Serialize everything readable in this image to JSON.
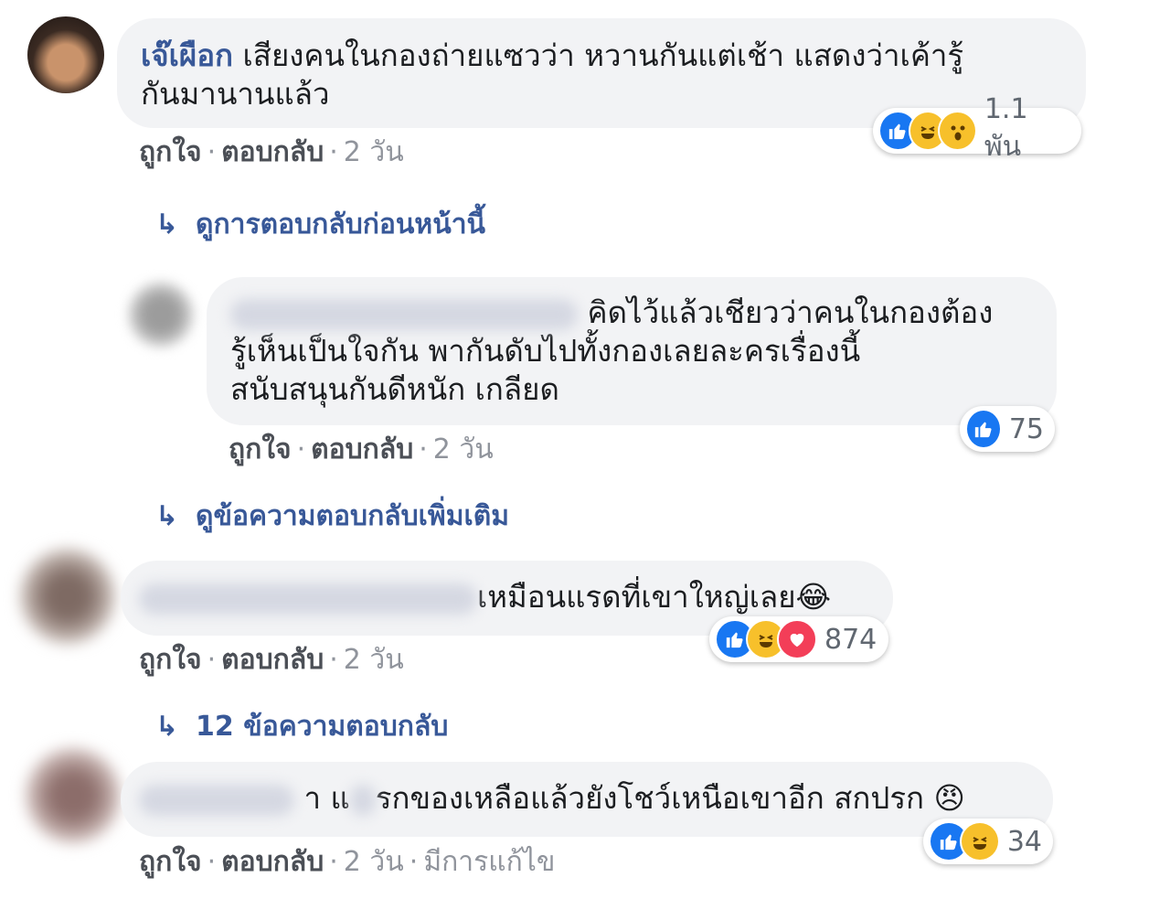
{
  "comments": [
    {
      "author": "เจ๊เผือก",
      "text": "เสียงคนในกองถ่ายแซวว่า หวานกันแต่เช้า แสดงว่าเค้ารู้กันมานานแล้ว",
      "line1": "เสียงคนในกองถ่ายแซวว่า หวานกันแต่เช้า แสดงว่าเค้ารู้",
      "line2": "กันมานานแล้ว",
      "like": "ถูกใจ",
      "reply": "ตอบกลับ",
      "time": "2 วัน",
      "reaction_icons": [
        "like-icon",
        "haha-icon",
        "wow-icon"
      ],
      "reaction_count": "1.1 พัน"
    },
    {
      "author": "",
      "line1": "คิดไว้แล้วเชียวว่าคนในกองต้อง",
      "line2": "รู้เห็นเป็นใจกัน พากันดับไปทั้งกองเลยละครเรื่องนี้",
      "line3": "สนับสนุนกันดีหนัก เกลียด",
      "like": "ถูกใจ",
      "reply": "ตอบกลับ",
      "time": "2 วัน",
      "reaction_icons": [
        "like-icon"
      ],
      "reaction_count": "75"
    },
    {
      "author": "",
      "text": "เหมือนแรดที่เขาใหญ่เลย",
      "emoji": "😂",
      "like": "ถูกใจ",
      "reply": "ตอบกลับ",
      "time": "2 วัน",
      "reaction_icons": [
        "like-icon",
        "haha-icon",
        "love-icon"
      ],
      "reaction_count": "874"
    },
    {
      "author": "",
      "text_a": "า แ",
      "text_b": "รกของเหลือแล้วยังโชว์เหนือเขาอีก สกปรก",
      "emoji": "😠",
      "like": "ถูกใจ",
      "reply": "ตอบกลับ",
      "time": "2 วัน",
      "edited": "มีการแก้ไข",
      "reaction_icons": [
        "like-icon",
        "haha-icon"
      ],
      "reaction_count": "34"
    }
  ],
  "links": {
    "previous_replies": "ดูการตอบกลับก่อนหน้านี้",
    "more_replies": "ดูข้อความตอบกลับเพิ่มเติม",
    "reply_count": "12 ข้อความตอบกลับ"
  },
  "separator": "·",
  "arrow": "↳",
  "colors": {
    "link": "#385898",
    "bubble": "#f2f3f5",
    "like": "#1877f2",
    "haha": "#f7c02b",
    "love": "#f33e58"
  }
}
